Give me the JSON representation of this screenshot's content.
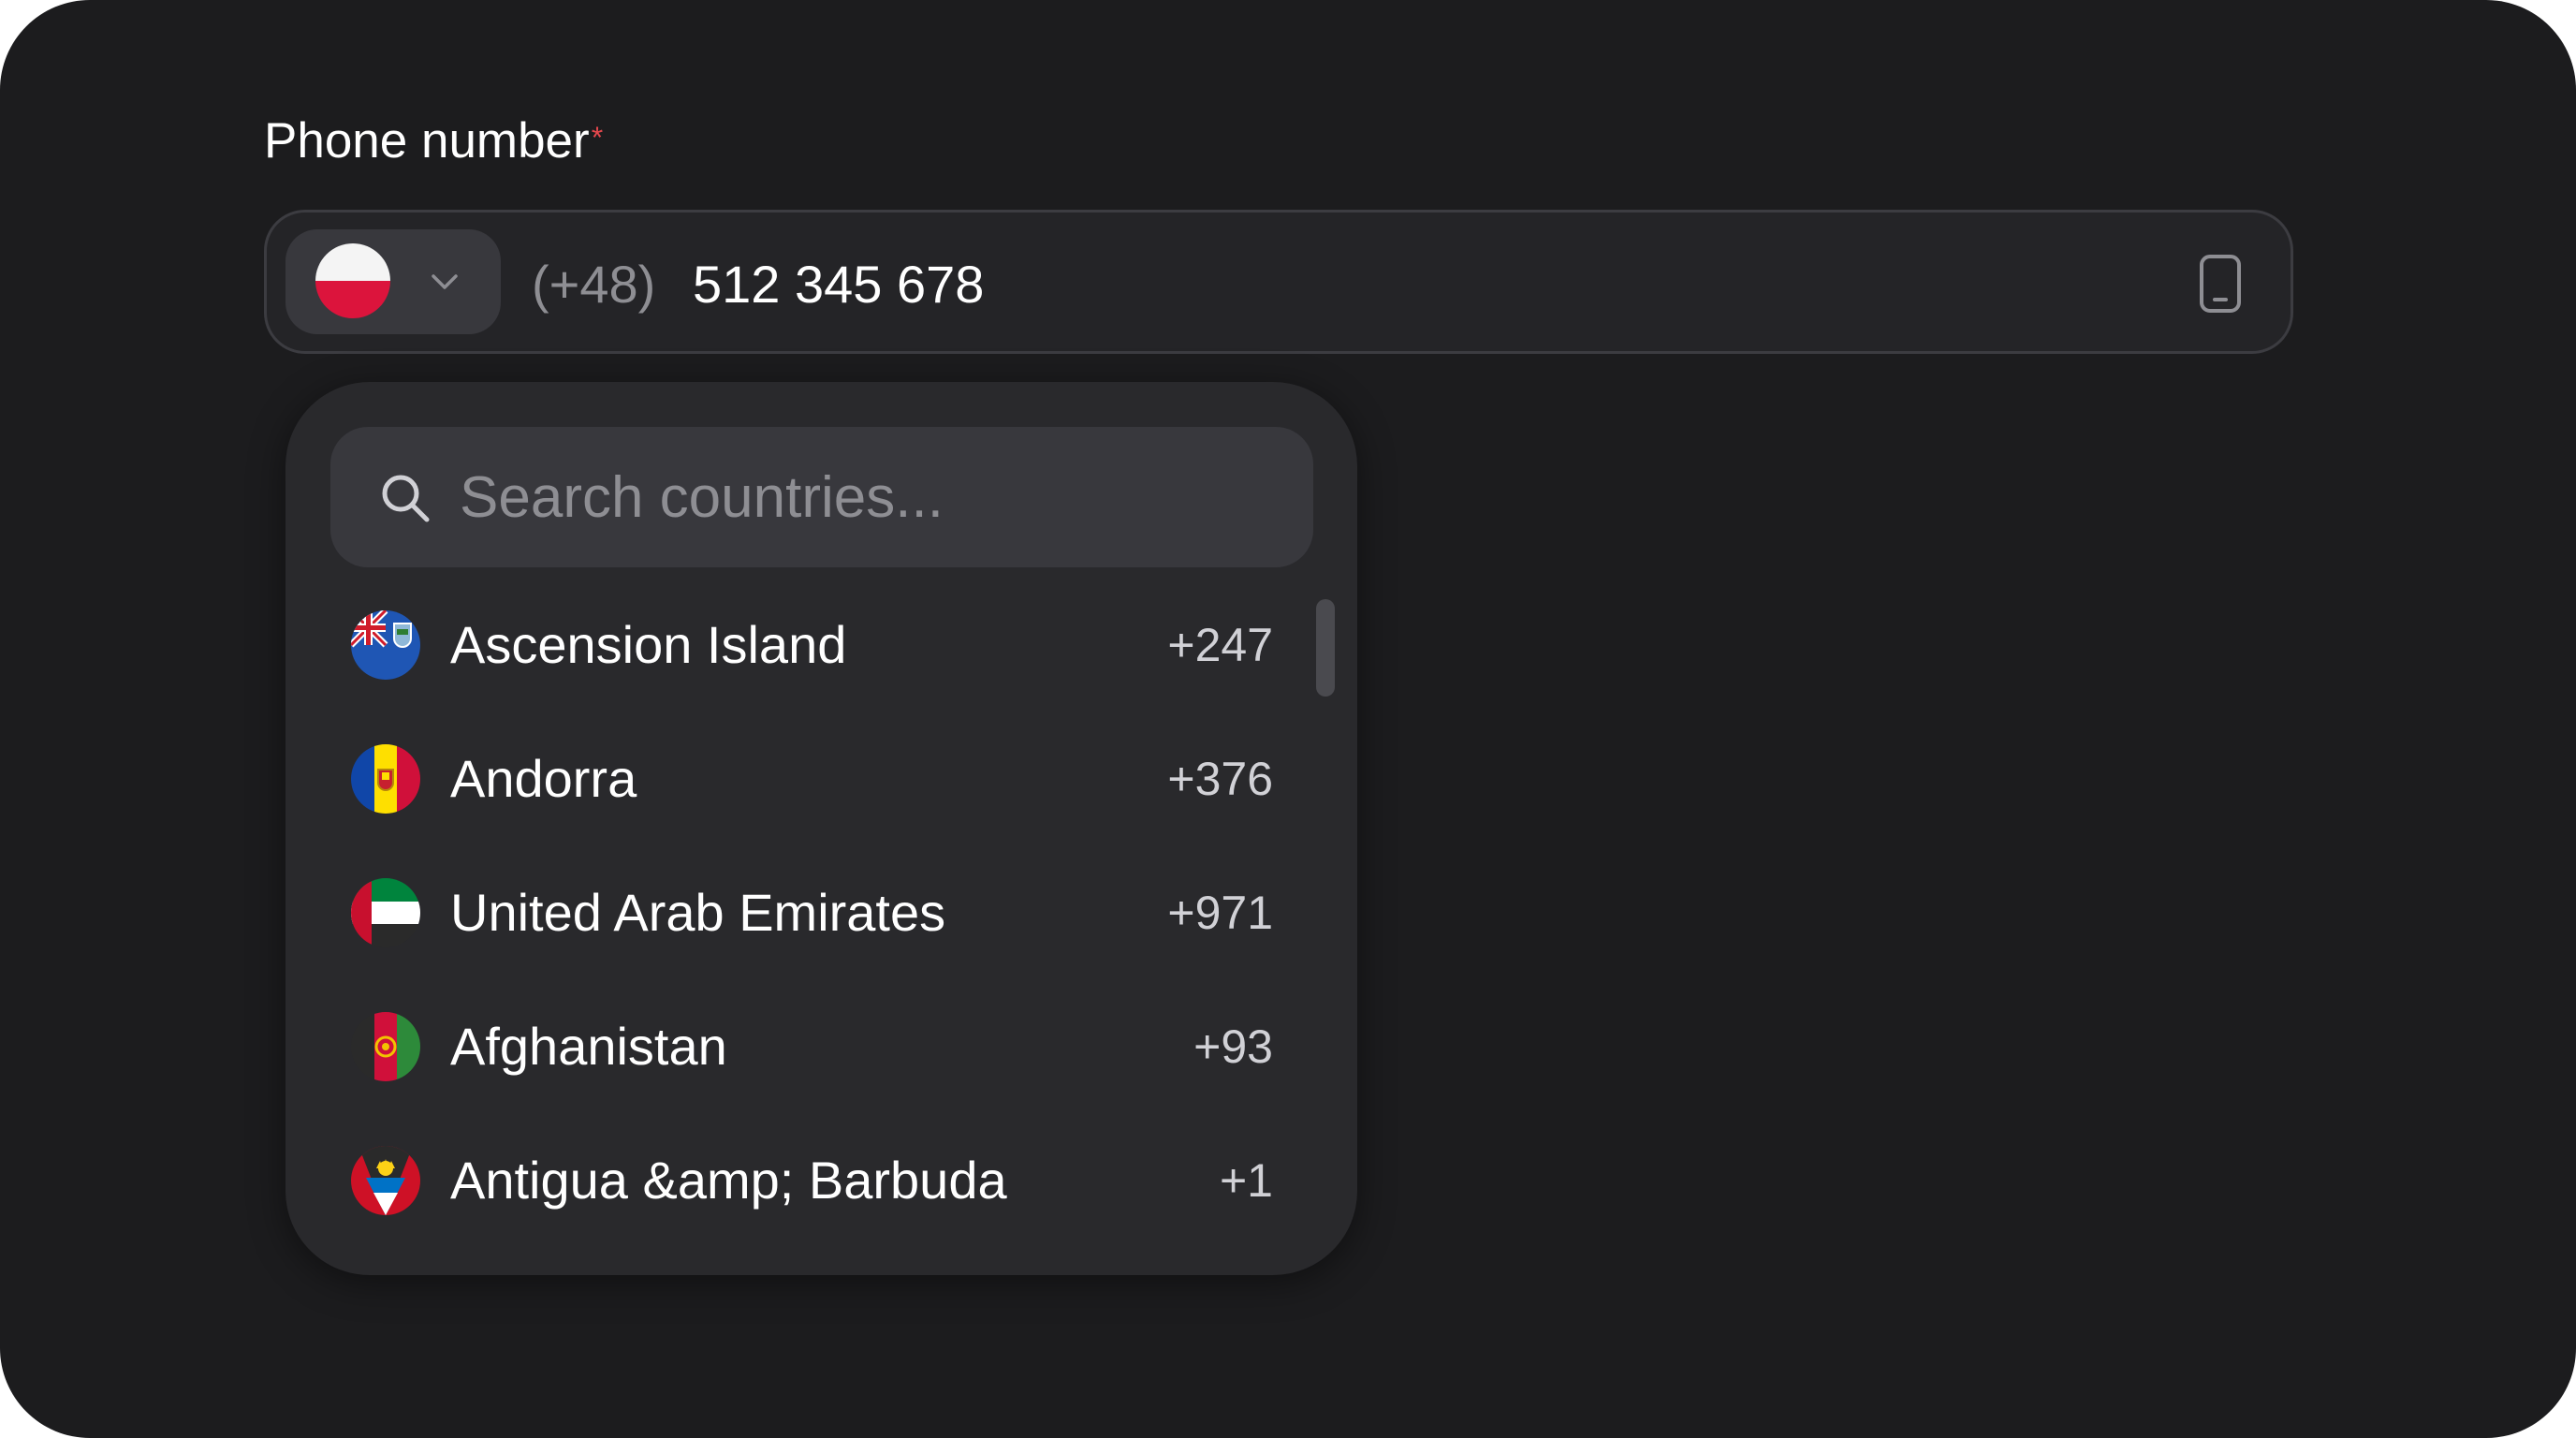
{
  "form": {
    "label": "Phone number",
    "required_mark": "*",
    "colors": {
      "background": "#1c1c1e",
      "required": "#e5484d"
    }
  },
  "phone_input": {
    "selected_country_flag": "poland-flag-icon",
    "dial_prefix": "(+48)",
    "value": "512 345 678",
    "trailing_icon": "mobile-phone-icon"
  },
  "dropdown": {
    "search": {
      "placeholder": "Search countries..."
    },
    "countries": [
      {
        "name": "Ascension Island",
        "code": "+247",
        "flag": "ascension-island-flag-icon"
      },
      {
        "name": "Andorra",
        "code": "+376",
        "flag": "andorra-flag-icon"
      },
      {
        "name": "United Arab Emirates",
        "code": "+971",
        "flag": "uae-flag-icon"
      },
      {
        "name": "Afghanistan",
        "code": "+93",
        "flag": "afghanistan-flag-icon"
      },
      {
        "name": "Antigua &amp; Barbuda",
        "code": "+1",
        "flag": "antigua-barbuda-flag-icon"
      }
    ]
  }
}
